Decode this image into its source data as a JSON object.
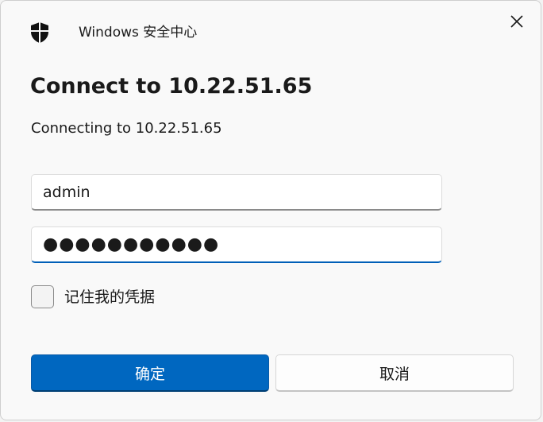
{
  "window": {
    "app_title": "Windows 安全中心",
    "icon": "shield-icon",
    "close_icon": "close-icon"
  },
  "dialog": {
    "heading": "Connect to 10.22.51.65",
    "subtext": "Connecting to 10.22.51.65",
    "username_value": "admin",
    "password_value": "●●●●●●●●●●●",
    "remember_label": "记住我的凭据",
    "remember_checked": false,
    "ok_label": "确定",
    "cancel_label": "取消"
  },
  "colors": {
    "accent": "#0067c0",
    "background": "#f9f9f9",
    "text": "#1a1a1a"
  }
}
